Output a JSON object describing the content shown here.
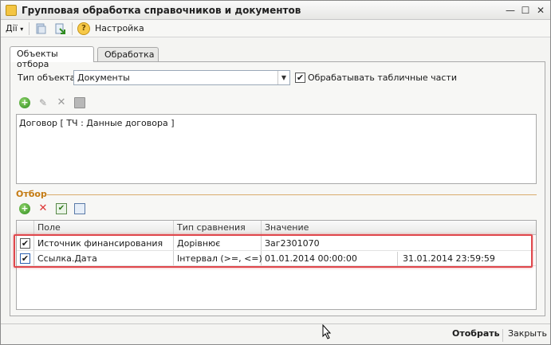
{
  "window": {
    "title": "Групповая обработка справочников и документов",
    "minimize": "—",
    "maximize": "☐",
    "close": "✕"
  },
  "toolbar": {
    "actions_label": "Дії",
    "actions_arrow": "▾",
    "help_symbol": "?",
    "settings_label": "Настройка"
  },
  "tabs": [
    {
      "label": "Объекты отбора",
      "active": true
    },
    {
      "label": "Обработка",
      "active": false
    }
  ],
  "object_type": {
    "label": "Тип объекта:",
    "value": "Документы",
    "dropdown_arrow": "▼"
  },
  "process_tables": {
    "label": "Обрабатывать табличные части",
    "checked": true
  },
  "objects_list": {
    "items": [
      "Договор [ ТЧ : Данные договора ]"
    ]
  },
  "filter": {
    "title": "Отбор",
    "columns": [
      "Поле",
      "Тип сравнения",
      "Значение"
    ],
    "rows": [
      {
        "checked": true,
        "field": "Источник финансирования",
        "comparison": "Дорівнює",
        "value": "Заг2301070",
        "value2": ""
      },
      {
        "checked": true,
        "field": "Ссылка.Дата",
        "comparison": "Інтервал (>=, <=)",
        "value": "01.01.2014 00:00:00",
        "value2": "31.01.2014 23:59:59"
      }
    ]
  },
  "footer": {
    "select_label": "Отобрать",
    "close_label": "Закрыть"
  },
  "colors": {
    "accent_group": "#c47a12",
    "highlight": "#e0474c"
  },
  "icons": {
    "checkmark": "✔",
    "plus": "+",
    "delete": "✕",
    "edit": "✎",
    "check_all": "✔"
  }
}
